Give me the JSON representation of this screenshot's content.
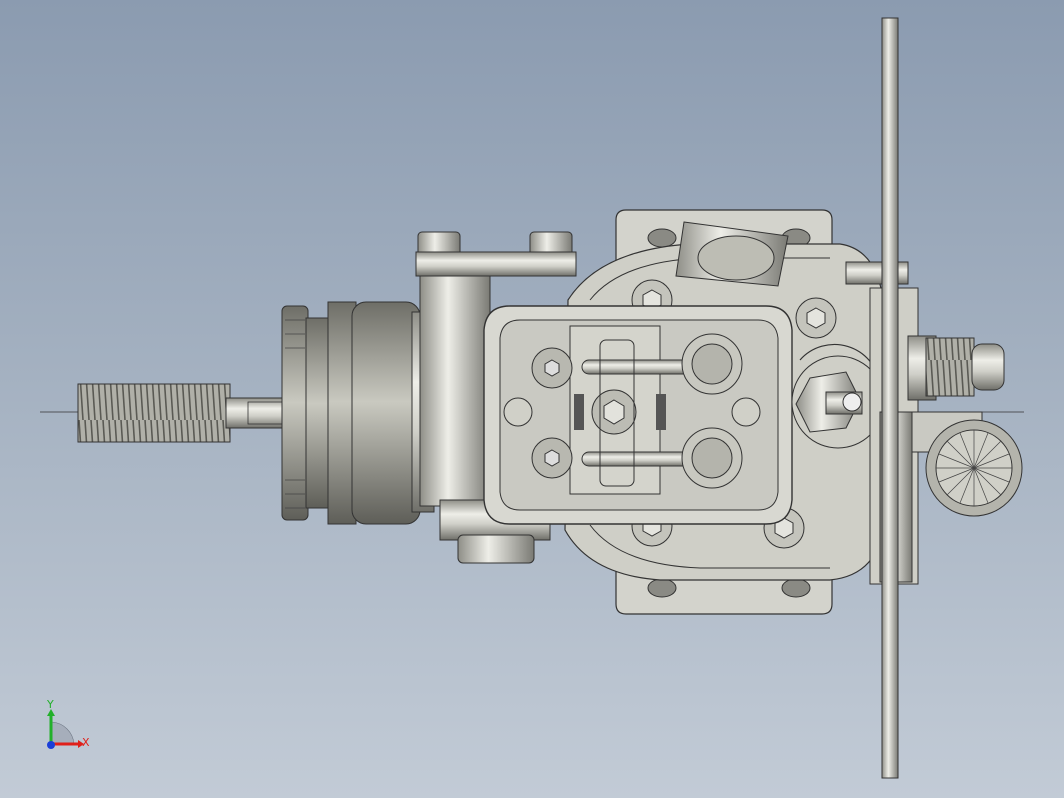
{
  "viewport": {
    "background_top": "#8b9bb0",
    "background_bottom": "#c2cbd6",
    "model_fill": "#d6d6cf",
    "model_shade": "#a9a9a1",
    "edge_color": "#2a2a2a"
  },
  "triad": {
    "x_label": "X",
    "y_label": "Y",
    "x_color": "#e0201a",
    "y_color": "#22b02a",
    "z_color": "#1a3fd8"
  }
}
